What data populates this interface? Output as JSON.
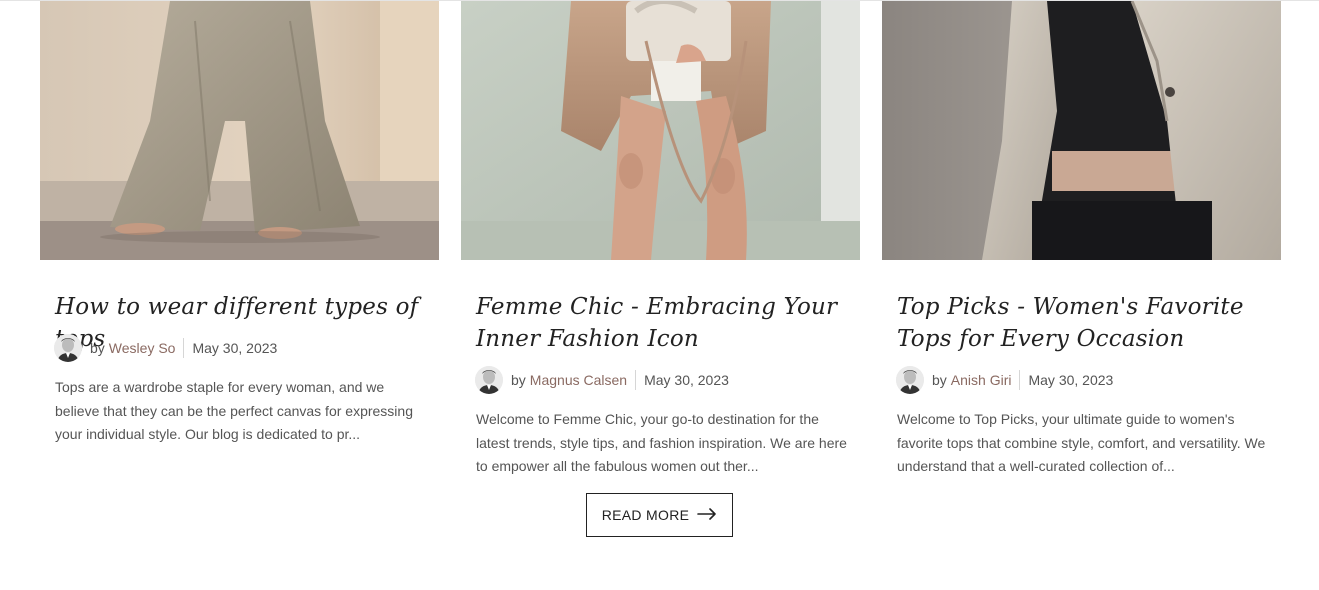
{
  "posts": [
    {
      "title": "How to wear different types of tops",
      "by": "by",
      "author": "Wesley So",
      "date": "May 30, 2023",
      "excerpt": "Tops are a wardrobe staple for every woman, and we believe that they can be the perfect canvas for expressing your individual style. Our blog is dedicated to pr..."
    },
    {
      "title": "Femme Chic - Embracing Your Inner Fashion Icon",
      "by": "by",
      "author": "Magnus Calsen",
      "date": "May 30, 2023",
      "excerpt": "Welcome to Femme Chic, your go-to destination for the latest trends, style tips, and fashion inspiration. We are here to empower all the fabulous women out ther..."
    },
    {
      "title": "Top Picks - Women's Favorite Tops for Every Occasion",
      "by": "by",
      "author": "Anish Giri",
      "date": "May 30, 2023",
      "excerpt": "Welcome to Top Picks, your ultimate guide to women's favorite tops that combine style, comfort, and versatility. We understand that a well-curated collection of..."
    }
  ],
  "read_more": {
    "label": "READ MORE",
    "icon": "arrow-right-icon"
  },
  "colors": {
    "author_link": "#8a6a62",
    "text": "#555555",
    "title": "#222222",
    "button_border": "#222222"
  }
}
